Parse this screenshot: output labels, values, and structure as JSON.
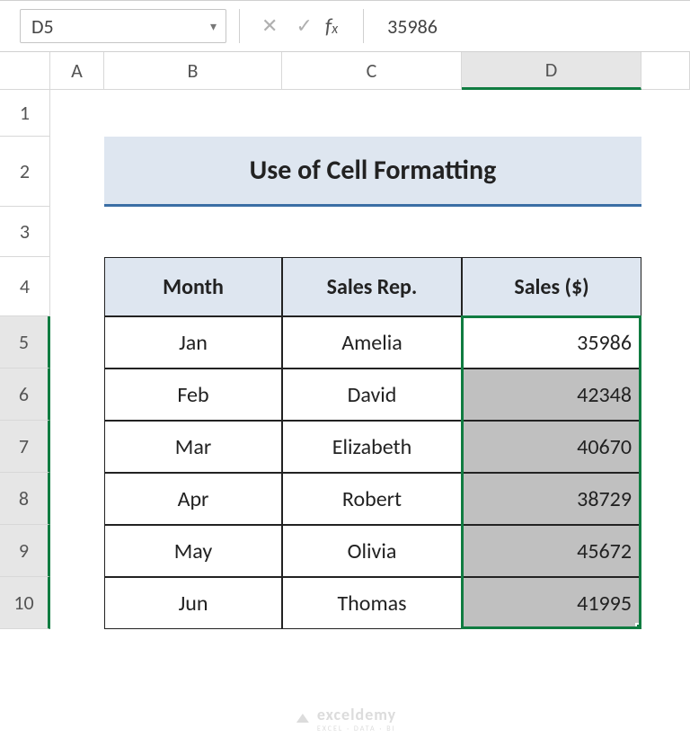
{
  "namebox": "D5",
  "formula_value": "35986",
  "columns": [
    "A",
    "B",
    "C",
    "D"
  ],
  "rows": [
    "1",
    "2",
    "3",
    "4",
    "5",
    "6",
    "7",
    "8",
    "9",
    "10"
  ],
  "title": "Use of Cell Formatting",
  "headers": {
    "month": "Month",
    "rep": "Sales Rep.",
    "sales": "Sales ($)"
  },
  "table": [
    {
      "month": "Jan",
      "rep": "Amelia",
      "sales": "35986"
    },
    {
      "month": "Feb",
      "rep": "David",
      "sales": "42348"
    },
    {
      "month": "Mar",
      "rep": "Elizabeth",
      "sales": "40670"
    },
    {
      "month": "Apr",
      "rep": "Robert",
      "sales": "38729"
    },
    {
      "month": "May",
      "rep": "Olivia",
      "sales": "45672"
    },
    {
      "month": "Jun",
      "rep": "Thomas",
      "sales": "41995"
    }
  ],
  "watermark": {
    "brand": "exceldemy",
    "tag": "EXCEL · DATA · BI"
  },
  "selected_column": "D",
  "selected_rows": [
    "5",
    "6",
    "7",
    "8",
    "9",
    "10"
  ],
  "chart_data": {
    "type": "table",
    "title": "Use of Cell Formatting",
    "columns": [
      "Month",
      "Sales Rep.",
      "Sales ($)"
    ],
    "rows": [
      [
        "Jan",
        "Amelia",
        35986
      ],
      [
        "Feb",
        "David",
        42348
      ],
      [
        "Mar",
        "Elizabeth",
        40670
      ],
      [
        "Apr",
        "Robert",
        38729
      ],
      [
        "May",
        "Olivia",
        45672
      ],
      [
        "Jun",
        "Thomas",
        41995
      ]
    ]
  }
}
